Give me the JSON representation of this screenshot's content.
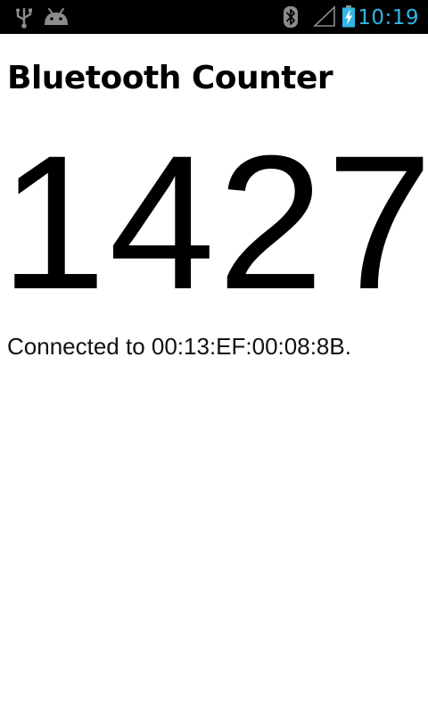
{
  "status_bar": {
    "time": "10:19",
    "time_color": "#33b5e5",
    "background": "#000000",
    "icons": [
      "usb-icon",
      "android-icon",
      "bluetooth-icon",
      "signal-icon",
      "battery-charging-icon"
    ]
  },
  "app": {
    "title": "Bluetooth Counter",
    "counter_value": "1427",
    "connection_status": "Connected to 00:13:EF:00:08:8B."
  }
}
